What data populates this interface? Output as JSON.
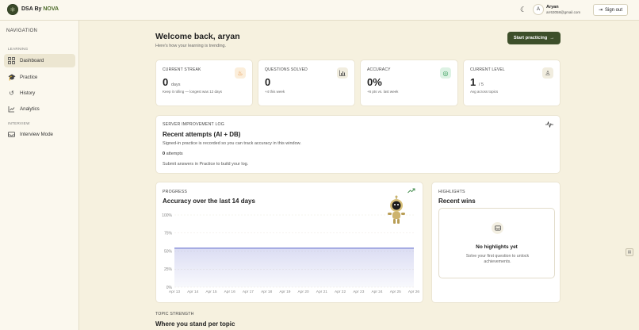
{
  "header": {
    "brand_prefix": "DSA By ",
    "brand_accent": "NOVA",
    "user_initial": "A",
    "user_name": "Aryan",
    "user_email": "arr63058@gmail.com",
    "signout_label": "Sign out"
  },
  "sidebar": {
    "title": "NAVIGATION",
    "sections": [
      {
        "label": "LEARNING"
      },
      {
        "label": "INTERVIEW"
      }
    ],
    "items": [
      {
        "label": "Dashboard",
        "icon": "grid-icon",
        "active": true
      },
      {
        "label": "Practice",
        "icon": "graduation-cap-icon",
        "active": false
      },
      {
        "label": "History",
        "icon": "history-icon",
        "active": false
      },
      {
        "label": "Analytics",
        "icon": "chart-icon",
        "active": false
      },
      {
        "label": "Interview Mode",
        "icon": "inbox-icon",
        "active": false
      }
    ]
  },
  "main": {
    "welcome": "Welcome back, aryan",
    "subtitle": "Here's how your learning is trending.",
    "start_label": "Start practicing"
  },
  "stats": [
    {
      "label": "CURRENT STREAK",
      "value": "0",
      "unit": "days",
      "note": "Keep it rolling — longest was 12 days",
      "icon": "flame-icon"
    },
    {
      "label": "QUESTIONS SOLVED",
      "value": "0",
      "unit": "",
      "note": "+4 this week",
      "icon": "bar-chart-icon"
    },
    {
      "label": "ACCURACY",
      "value": "0%",
      "unit": "",
      "note": "+6 pts vs. last week",
      "icon": "target-icon"
    },
    {
      "label": "CURRENT LEVEL",
      "value": "1",
      "unit": "/ 5",
      "note": "Avg across topics",
      "icon": "medal-icon"
    }
  ],
  "log": {
    "label": "SERVER IMPROVEMENT LOG",
    "title": "Recent attempts (AI + DB)",
    "description": "Signed-in practice is recorded so you can track accuracy in this window.",
    "count": "0",
    "count_suffix": "attempts",
    "hint": "Submit answers in Practice to build your log."
  },
  "progress": {
    "label": "PROGRESS",
    "title": "Accuracy over the last 14 days"
  },
  "chart_data": {
    "type": "area",
    "title": "Accuracy over the last 14 days",
    "x": [
      "Apr 13",
      "Apr 14",
      "Apr 15",
      "Apr 16",
      "Apr 17",
      "Apr 18",
      "Apr 19",
      "Apr 20",
      "Apr 21",
      "Apr 22",
      "Apr 23",
      "Apr 24",
      "Apr 25",
      "Apr 26"
    ],
    "y_ticks": [
      "0%",
      "25%",
      "50%",
      "75%",
      "100%"
    ],
    "values": [
      54,
      54,
      54,
      54,
      54,
      54,
      54,
      54,
      54,
      54,
      54,
      54,
      54,
      54
    ],
    "ylim": [
      0,
      100
    ],
    "grid": true,
    "color": "#5b63c9"
  },
  "highlights": {
    "label": "HIGHLIGHTS",
    "title": "Recent wins",
    "empty_title": "No highlights yet",
    "empty_text": "Solve your first question to unlock achievements."
  },
  "topics": {
    "label": "TOPIC STRENGTH",
    "title": "Where you stand per topic"
  }
}
